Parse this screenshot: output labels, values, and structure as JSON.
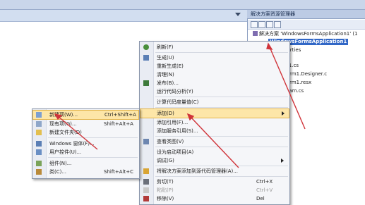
{
  "solution_explorer": {
    "title": "解决方案资源管理器",
    "items": [
      {
        "label": "解决方案 'WindowsFormsApplication1' (1"
      },
      {
        "label": "WindowsFormsApplication1",
        "selected": true
      },
      {
        "label": "perties"
      },
      {
        "label": "m1.cs"
      },
      {
        "label": "Form1.Designer.c"
      },
      {
        "label": "Form1.resx"
      },
      {
        "label": "gram.cs"
      }
    ]
  },
  "main_menu": {
    "items": [
      {
        "label": "刷新(F)",
        "icon": "refresh-icon"
      },
      {
        "label": "生成(U)",
        "icon": "build-icon"
      },
      {
        "label": "重新生成(E)"
      },
      {
        "label": "清理(N)"
      },
      {
        "label": "发布(B)...",
        "icon": "publish-icon"
      },
      {
        "label": "运行代码分析(Y)"
      },
      {
        "label": "计算代码度量值(C)"
      },
      {
        "label": "添加(D)",
        "highlighted": true,
        "submenu": true
      },
      {
        "label": "添加引用(F)..."
      },
      {
        "label": "添加服务引用(S)..."
      },
      {
        "label": "查看类图(V)",
        "icon": "class-diagram-icon"
      },
      {
        "label": "设为启动项目(A)"
      },
      {
        "label": "调试(G)",
        "submenu": true
      },
      {
        "label": "将解决方案添加到源代码管理器(A)...",
        "icon": "source-control-icon"
      },
      {
        "label": "剪切(T)",
        "shortcut": "Ctrl+X",
        "icon": "cut-icon"
      },
      {
        "label": "粘贴(P)",
        "shortcut": "Ctrl+V",
        "disabled": true,
        "icon": "paste-icon"
      },
      {
        "label": "移除(V)",
        "shortcut": "Del",
        "icon": "remove-icon"
      }
    ]
  },
  "add_submenu": {
    "items": [
      {
        "label": "新建项(W)...",
        "shortcut": "Ctrl+Shift+A",
        "highlighted": true,
        "icon": "new-item-icon"
      },
      {
        "label": "现有项(G)...",
        "shortcut": "Shift+Alt+A",
        "icon": "existing-item-icon"
      },
      {
        "label": "新建文件夹(D)",
        "icon": "folder-icon"
      },
      {
        "label": "Windows 窗体(F)...",
        "icon": "form-icon"
      },
      {
        "label": "用户控件(U)...",
        "icon": "user-control-icon"
      },
      {
        "label": "组件(N)...",
        "icon": "component-icon"
      },
      {
        "label": "类(C)...",
        "shortcut": "Shift+Alt+C",
        "icon": "class-icon"
      }
    ]
  },
  "colors": {
    "highlight": "#fde6a8",
    "selection": "#3167c6",
    "annotation_arrow": "#d0343a"
  }
}
